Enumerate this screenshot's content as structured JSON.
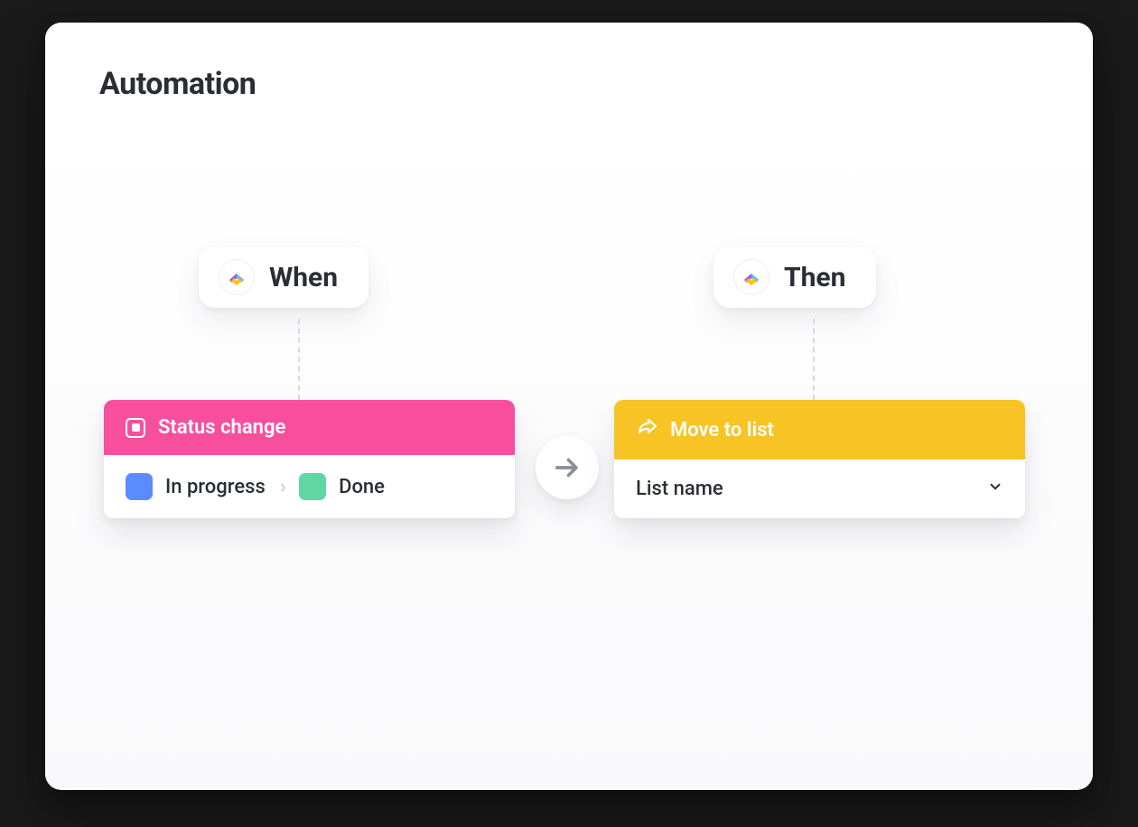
{
  "header": {
    "title": "Automation"
  },
  "when": {
    "pill_label": "When",
    "trigger_label": "Status change",
    "from_status": {
      "label": "In progress",
      "color": "#5c8bff"
    },
    "to_status": {
      "label": "Done",
      "color": "#5fd6a3"
    }
  },
  "then": {
    "pill_label": "Then",
    "action_label": "Move to list",
    "list_placeholder": "List name"
  },
  "colors": {
    "trigger_header": "#f74f9e",
    "action_header": "#f7c325"
  }
}
